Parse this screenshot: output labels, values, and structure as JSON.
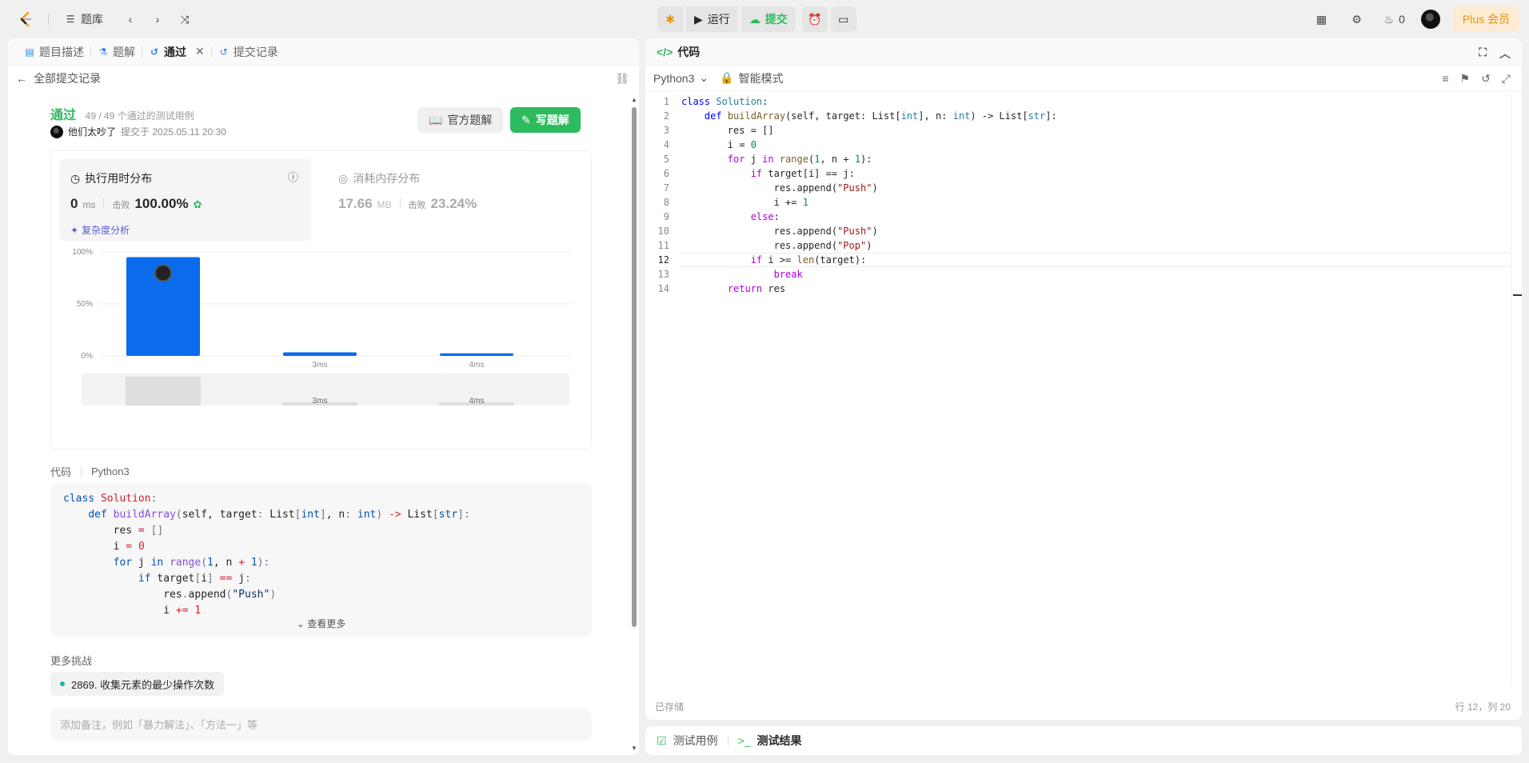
{
  "topbar": {
    "problem_bank": "题库",
    "run": "运行",
    "submit": "提交",
    "streak": "0",
    "plus": "Plus 会员"
  },
  "left": {
    "tabs": [
      "题目描述",
      "题解",
      "通过",
      "提交记录"
    ],
    "all_submissions": "全部提交记录",
    "status": "通过",
    "tests": "49 / 49 个通过的测试用例",
    "author": "他们太吵了",
    "submitted_at": "提交于 2025.05.11 20:30",
    "official_solution": "官方题解",
    "write_solution": "写题解",
    "runtime": {
      "title": "执行用时分布",
      "value": "0",
      "unit": "ms",
      "beats_label": "击败",
      "beats": "100.00%",
      "complexity": "复杂度分析"
    },
    "memory": {
      "title": "消耗内存分布",
      "value": "17.66",
      "unit": "MB",
      "beats_label": "击败",
      "beats": "23.24%"
    },
    "code_label": "代码",
    "code_lang": "Python3",
    "see_more": "查看更多",
    "more_challenges": "更多挑战",
    "challenge": "2869. 收集元素的最少操作次数",
    "note_placeholder": "添加备注，例如「暴力解法」、「方法一」等"
  },
  "chart_data": {
    "type": "bar",
    "categories": [
      "",
      "3ms",
      "4ms"
    ],
    "values": [
      95,
      3.5,
      2.5
    ],
    "ylim": [
      0,
      100
    ],
    "y_ticks": [
      "0%",
      "50%",
      "100%"
    ],
    "grid": true,
    "colors": {
      "bar": "#0a6ced",
      "grid": "#eeeeee"
    },
    "minimap_labels": [
      "",
      "3ms",
      "4ms"
    ]
  },
  "right": {
    "title": "代码",
    "lang": "Python3",
    "mode": "智能模式",
    "saved": "已存储",
    "cursor": "行 12，列 20",
    "current_line": 12
  },
  "bottom": {
    "testcase": "测试用例",
    "result": "测试结果"
  }
}
